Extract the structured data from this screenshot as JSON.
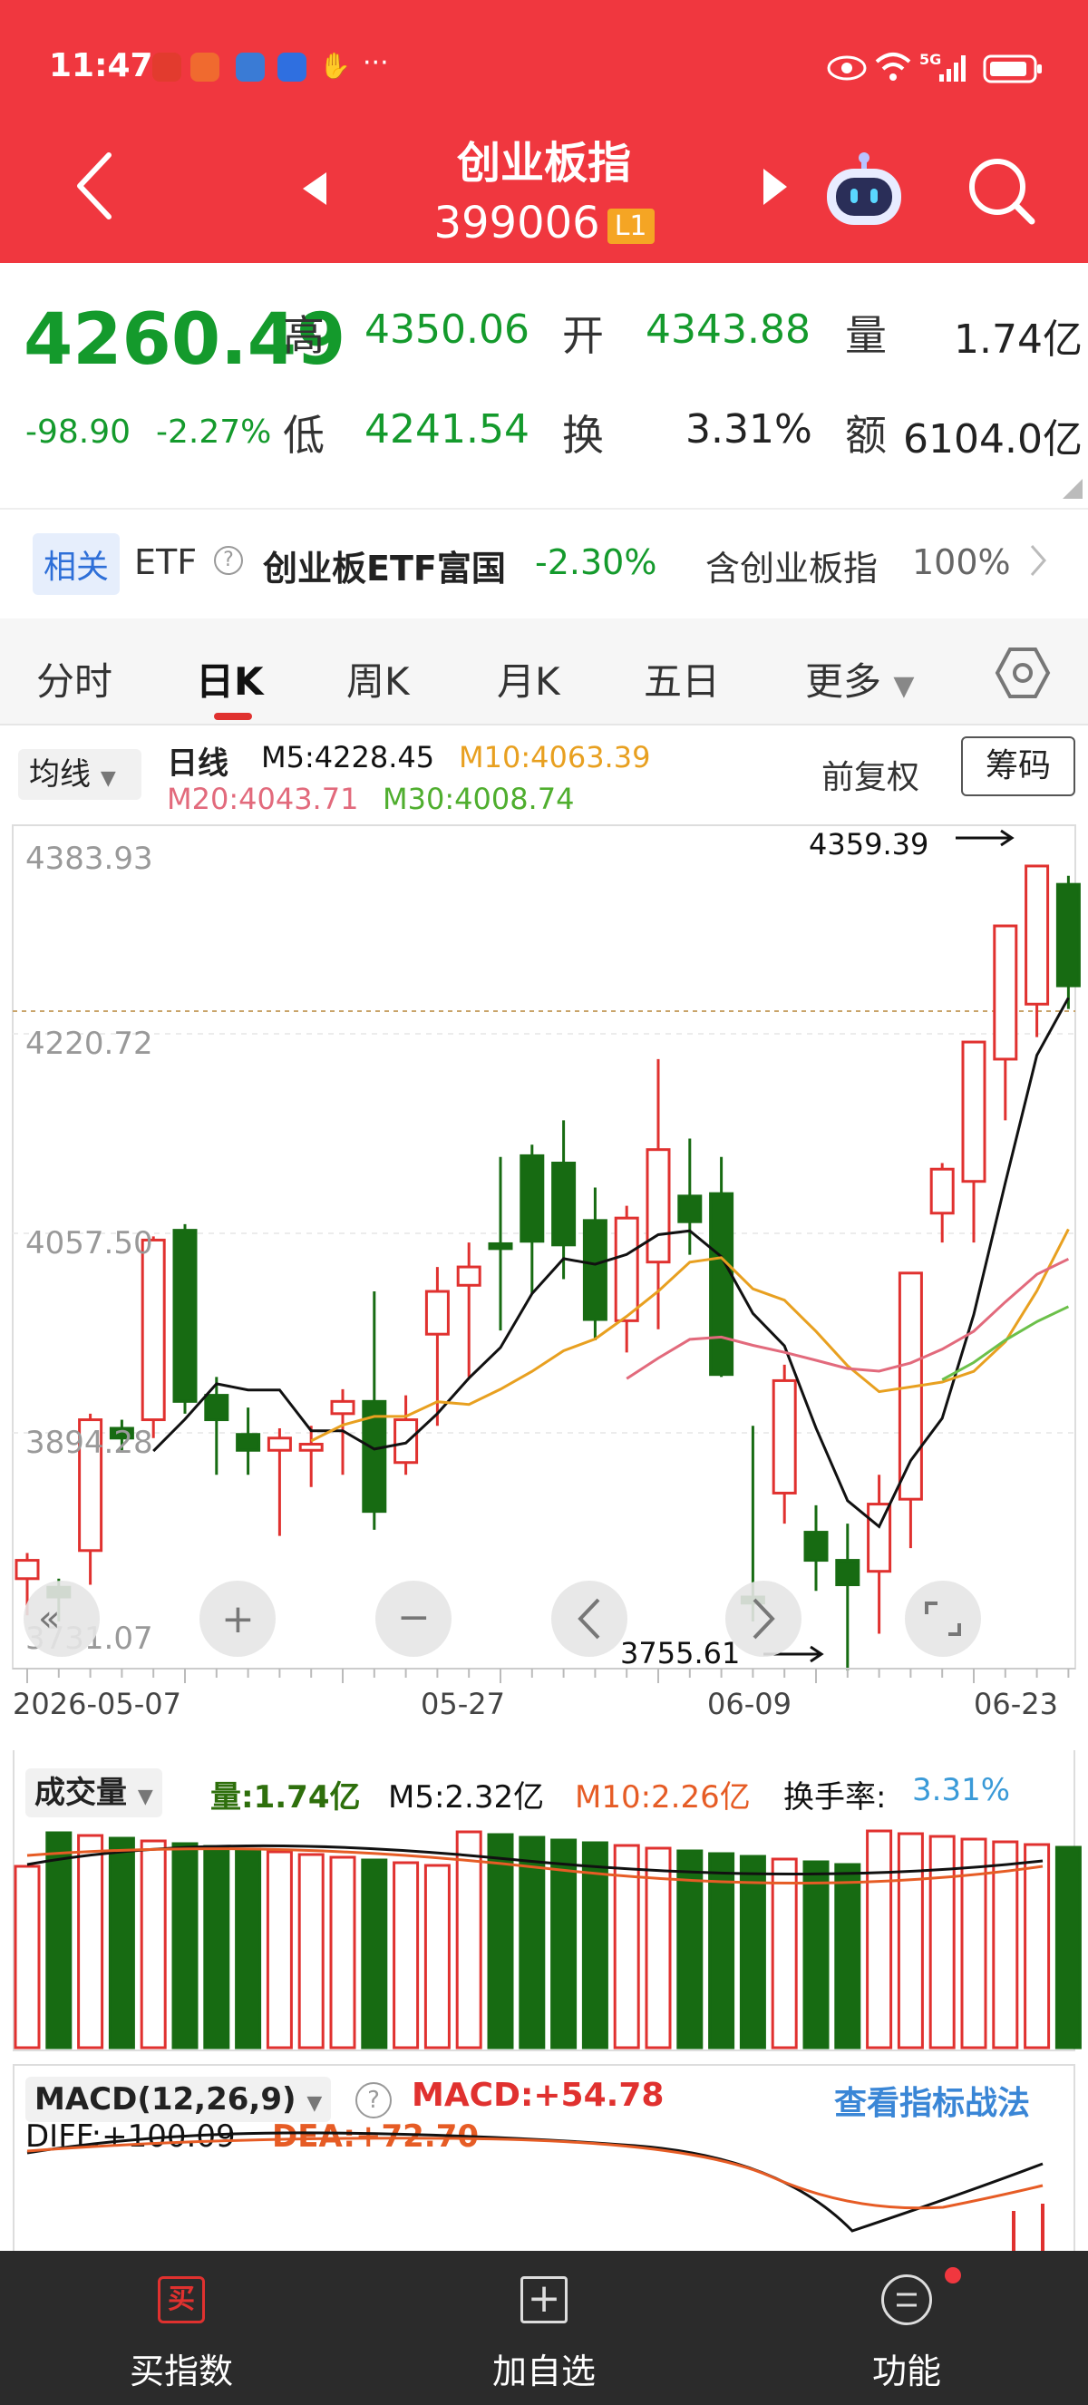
{
  "status": {
    "time": "11:47",
    "network": "5G"
  },
  "header": {
    "title": "创业板指",
    "code": "399006",
    "level_badge": "L1"
  },
  "quote": {
    "price": "4260.49",
    "change": "-98.90",
    "change_pct": "-2.27%",
    "high_label": "高",
    "high": "4350.06",
    "open_label": "开",
    "open": "4343.88",
    "vol_label": "量",
    "vol": "1.74亿",
    "low_label": "低",
    "low": "4241.54",
    "turnover_label": "换",
    "turnover": "3.31%",
    "amount_label": "额",
    "amount": "6104.0亿"
  },
  "related": {
    "tag": "相关",
    "type": "ETF",
    "etf_name": "创业板ETF富国",
    "etf_change": "-2.30%",
    "contains_text": "含创业板指",
    "contains_pct": "100%"
  },
  "tabs": [
    "分时",
    "日K",
    "周K",
    "月K",
    "五日",
    "更多"
  ],
  "active_tab_index": 1,
  "kline": {
    "ma_selector": "均线",
    "period_label": "日线",
    "m5": "M5:4228.45",
    "m10": "M10:4063.39",
    "m20": "M20:4043.71",
    "m30": "M30:4008.74",
    "adjust_label": "前复权",
    "chips_button": "筹码",
    "y_labels": [
      "4383.93",
      "4220.72",
      "4057.50",
      "3894.28",
      "3731.07"
    ],
    "high_marker": "4359.39",
    "low_marker": "3755.61",
    "x_labels": [
      "2026-05-07",
      "05-27",
      "06-09",
      "06-23"
    ],
    "colors": {
      "up": "#e0312f",
      "down": "#176b12",
      "m5": "#111111",
      "m10": "#e8a020",
      "m20": "#e26a7c",
      "m30": "#6cc04a"
    }
  },
  "volume": {
    "selector": "成交量",
    "vol": "量:1.74亿",
    "m5": "M5:2.32亿",
    "m10": "M10:2.26亿",
    "turnover_label": "换手率:",
    "turnover": "3.31%"
  },
  "macd": {
    "selector": "MACD(12,26,9)",
    "macd": "MACD:+54.78",
    "diff": "DIFF:+100.09",
    "dea": "DEA:+72.70",
    "strategy_link": "查看指标战法"
  },
  "bottom": {
    "buy": "买指数",
    "buy_icon": "买",
    "add": "加自选",
    "func": "功能"
  },
  "chart_data": {
    "type": "candlestick",
    "x": [
      "05-07",
      "05-08",
      "05-11",
      "05-12",
      "05-13",
      "05-14",
      "05-15",
      "05-18",
      "05-19",
      "05-20",
      "05-21",
      "05-22",
      "05-25",
      "05-26",
      "05-27",
      "05-28",
      "05-29",
      "06-01",
      "06-02",
      "06-03",
      "06-04",
      "06-05",
      "06-08",
      "06-09",
      "06-10",
      "06-11",
      "06-12",
      "06-15",
      "06-16",
      "06-17",
      "06-18",
      "06-19",
      "06-22",
      "06-23"
    ],
    "ohlc": [
      [
        3775,
        3796,
        3745,
        3790
      ],
      [
        3768,
        3775,
        3740,
        3760
      ],
      [
        3798,
        3910,
        3770,
        3905
      ],
      [
        3898,
        3905,
        3880,
        3890
      ],
      [
        3905,
        4055,
        3890,
        4052
      ],
      [
        4060,
        4065,
        3910,
        3920
      ],
      [
        3925,
        3940,
        3860,
        3905
      ],
      [
        3893,
        3915,
        3860,
        3880
      ],
      [
        3880,
        3898,
        3810,
        3890
      ],
      [
        3880,
        3900,
        3850,
        3885
      ],
      [
        3910,
        3930,
        3860,
        3920
      ],
      [
        3920,
        4010,
        3815,
        3830
      ],
      [
        3870,
        3925,
        3860,
        3905
      ],
      [
        3975,
        4030,
        3900,
        4010
      ],
      [
        4015,
        4050,
        3940,
        4030
      ],
      [
        4049,
        4120,
        3978,
        4045
      ],
      [
        4121,
        4130,
        4008,
        4051
      ],
      [
        4115,
        4150,
        4020,
        4048
      ],
      [
        4068,
        4095,
        3970,
        3987
      ],
      [
        3986,
        4080,
        3960,
        4070
      ],
      [
        4034,
        4200,
        3979,
        4126
      ],
      [
        4088,
        4135,
        4040,
        4067
      ],
      [
        4090,
        4120,
        3940,
        3942
      ],
      [
        3760,
        3900,
        3740,
        3755
      ],
      [
        3845,
        3950,
        3820,
        3937
      ],
      [
        3813,
        3835,
        3765,
        3790
      ],
      [
        3790,
        3820,
        3700,
        3770
      ],
      [
        3781,
        3860,
        3730,
        3836
      ],
      [
        3840,
        4020,
        3800,
        4025
      ],
      [
        4074,
        4115,
        4050,
        4110
      ],
      [
        4100,
        4200,
        4050,
        4214
      ],
      [
        4200,
        4290,
        4150,
        4309
      ],
      [
        4245,
        4359,
        4218,
        4358
      ],
      [
        4343,
        4350,
        4241,
        4260
      ]
    ],
    "ylim": [
      3731.07,
      4383.93
    ],
    "series": [
      {
        "name": "M5",
        "last": 4228.45
      },
      {
        "name": "M10",
        "last": 4063.39
      },
      {
        "name": "M20",
        "last": 4043.71
      },
      {
        "name": "M30",
        "last": 4008.74
      }
    ]
  }
}
